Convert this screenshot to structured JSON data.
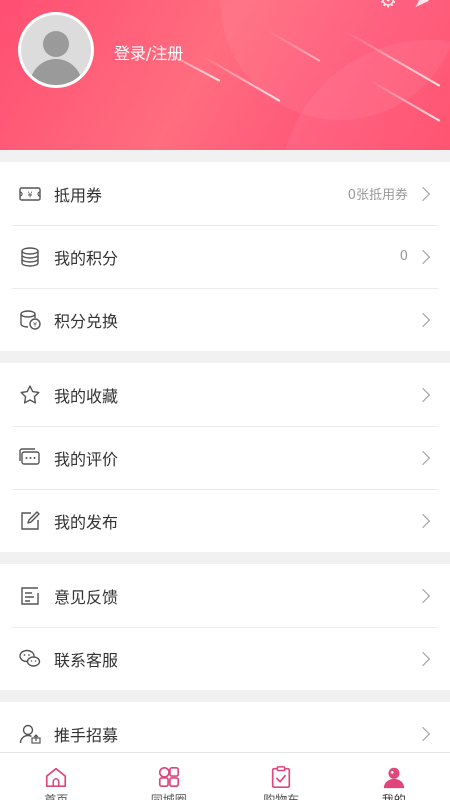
{
  "header": {
    "login_label": "登录/注册"
  },
  "group1": [
    {
      "label": "抵用券",
      "value": "0张抵用券",
      "icon": "voucher-icon"
    },
    {
      "label": "我的积分",
      "value": "0",
      "icon": "coins-icon"
    },
    {
      "label": "积分兑换",
      "value": "",
      "icon": "points-exchange-icon"
    }
  ],
  "group2": [
    {
      "label": "我的收藏",
      "icon": "star-icon"
    },
    {
      "label": "我的评价",
      "icon": "comment-icon"
    },
    {
      "label": "我的发布",
      "icon": "edit-icon"
    }
  ],
  "group3": [
    {
      "label": "意见反馈",
      "icon": "feedback-icon"
    },
    {
      "label": "联系客服",
      "icon": "wechat-icon"
    }
  ],
  "group4": [
    {
      "label": "推手招募",
      "icon": "user-upload-icon"
    }
  ],
  "tabs": [
    {
      "label": "首页",
      "icon": "home-icon"
    },
    {
      "label": "同城圈",
      "icon": "grid-icon"
    },
    {
      "label": "购物车",
      "icon": "cart-clipboard-icon"
    },
    {
      "label": "我的",
      "icon": "profile-icon",
      "active": true
    }
  ],
  "colors": {
    "accent": "#ff4f72",
    "tab_icon": "#e0457b"
  }
}
